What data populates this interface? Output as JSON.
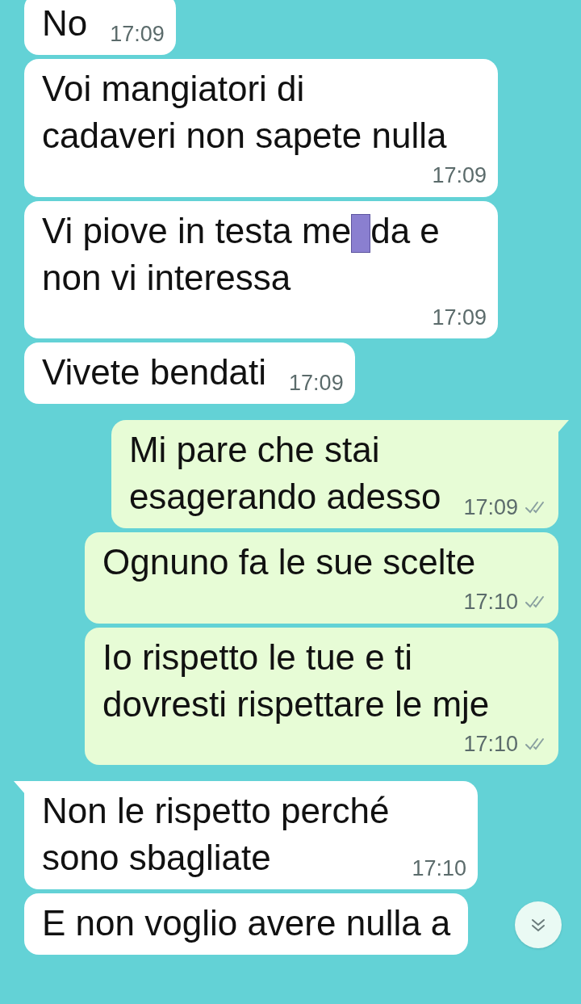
{
  "messages": [
    {
      "outgoing": false,
      "tail": false,
      "text": "No",
      "time": "17:09"
    },
    {
      "outgoing": false,
      "tail": false,
      "text": "Voi mangiatori di\ncadaveri non sapete nulla",
      "time": "17:09"
    },
    {
      "outgoing": false,
      "tail": false,
      "text": "Vi piove in testa me",
      "redacted": true,
      "text_after": "da e\nnon vi interessa",
      "time": "17:09"
    },
    {
      "outgoing": false,
      "tail": false,
      "text": "Vivete bendati",
      "time": "17:09"
    },
    {
      "outgoing": true,
      "tail": true,
      "text": "Mi pare che stai\nesagerando adesso",
      "time": "17:09",
      "read": false
    },
    {
      "outgoing": true,
      "tail": false,
      "text": "Ognuno fa le sue scelte",
      "time": "17:10",
      "read": false
    },
    {
      "outgoing": true,
      "tail": false,
      "text": "Io rispetto le tue e ti\ndovresti rispettare le mje",
      "time": "17:10",
      "read": false
    },
    {
      "outgoing": false,
      "tail": true,
      "text": "Non le rispetto perché\nsono sbagliate",
      "time": "17:10"
    },
    {
      "outgoing": false,
      "tail": false,
      "text": "E non voglio avere nulla a"
    }
  ]
}
